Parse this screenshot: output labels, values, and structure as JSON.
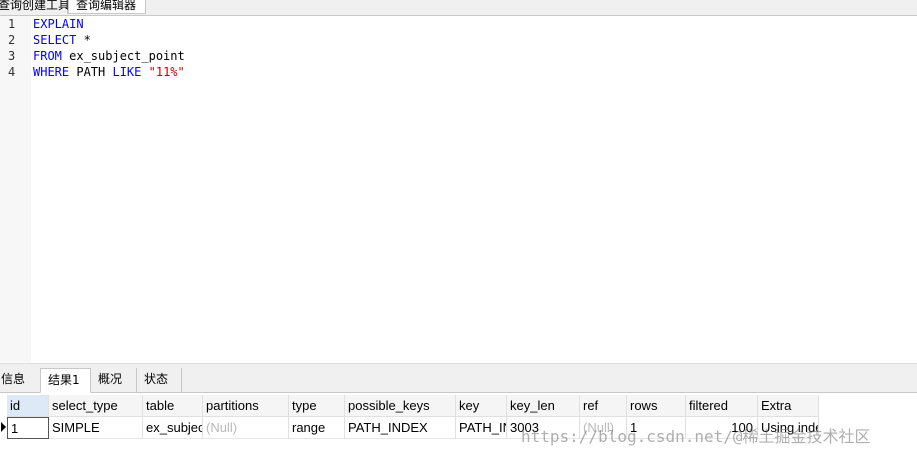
{
  "tabs": {
    "builder_label": "查询创建工具",
    "editor_label": "查询编辑器"
  },
  "editor": {
    "lines": [
      {
        "num": "1",
        "kw": "EXPLAIN",
        "rest": "",
        "str": ""
      },
      {
        "num": "2",
        "kw": "SELECT",
        "rest": " *",
        "str": ""
      },
      {
        "num": "3",
        "kw": "FROM",
        "rest": " ex_subject_point",
        "str": ""
      },
      {
        "num": "4",
        "kw": "WHERE",
        "rest": " PATH ",
        "kw2": "LIKE",
        "str": " \"11%\""
      }
    ]
  },
  "result_tabs": [
    "信息",
    "结果1",
    "概况",
    "状态"
  ],
  "grid": {
    "columns": [
      "id",
      "select_type",
      "table",
      "partitions",
      "type",
      "possible_keys",
      "key",
      "key_len",
      "ref",
      "rows",
      "filtered",
      "Extra"
    ],
    "row": [
      "1",
      "SIMPLE",
      "ex_subject_point",
      "(Null)",
      "range",
      "PATH_INDEX",
      "PATH_INDEX",
      "3003",
      "(Null)",
      "1",
      "100",
      "Using index condition"
    ]
  },
  "watermark": "https://blog.csdn.net/@稀土掘金技术社区"
}
